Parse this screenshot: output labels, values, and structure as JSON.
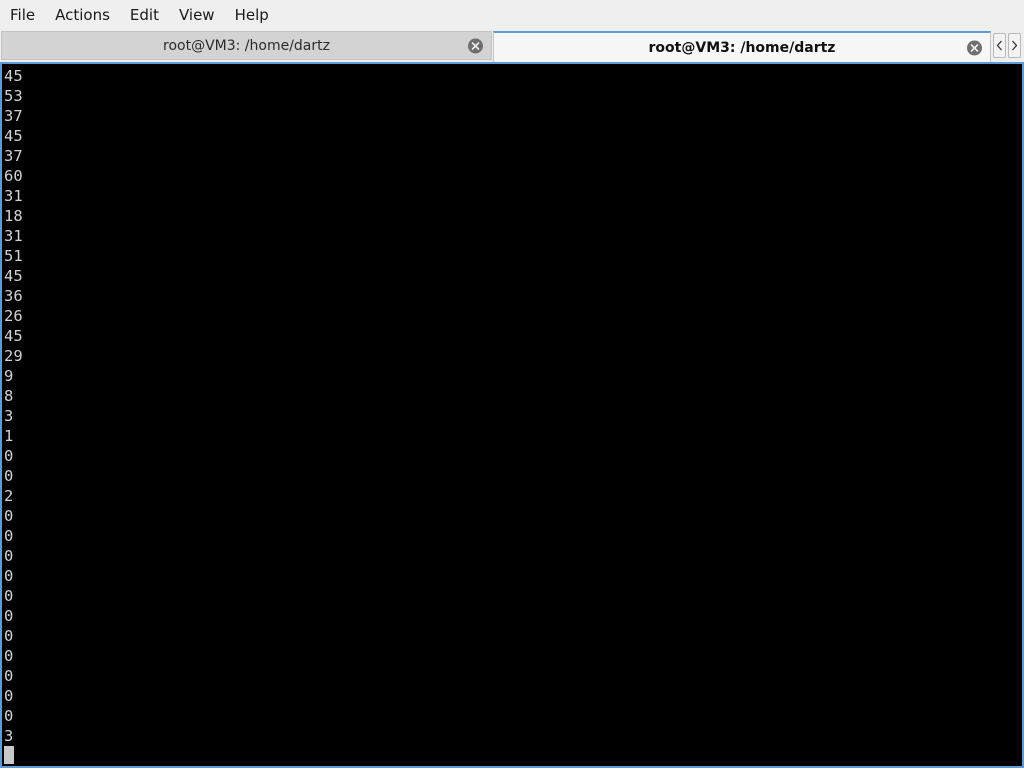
{
  "menubar": {
    "items": [
      "File",
      "Actions",
      "Edit",
      "View",
      "Help"
    ]
  },
  "tabs": [
    {
      "label": "root@VM3: /home/dartz",
      "active": false
    },
    {
      "label": "root@VM3: /home/dartz",
      "active": true
    }
  ],
  "icons": {
    "tab_close": "close-circle-icon",
    "scroll_left": "chevron-left-icon",
    "scroll_right": "chevron-right-icon"
  },
  "colors": {
    "accent": "#5e9ad6",
    "terminal_bg": "#000000",
    "terminal_fg": "#d2d2d2"
  },
  "terminal": {
    "lines": [
      "45",
      "53",
      "37",
      "45",
      "37",
      "60",
      "31",
      "18",
      "31",
      "51",
      "45",
      "36",
      "26",
      "45",
      "29",
      "9",
      "8",
      "3",
      "1",
      "0",
      "0",
      "2",
      "0",
      "0",
      "0",
      "0",
      "0",
      "0",
      "0",
      "0",
      "0",
      "0",
      "0",
      "3"
    ]
  }
}
